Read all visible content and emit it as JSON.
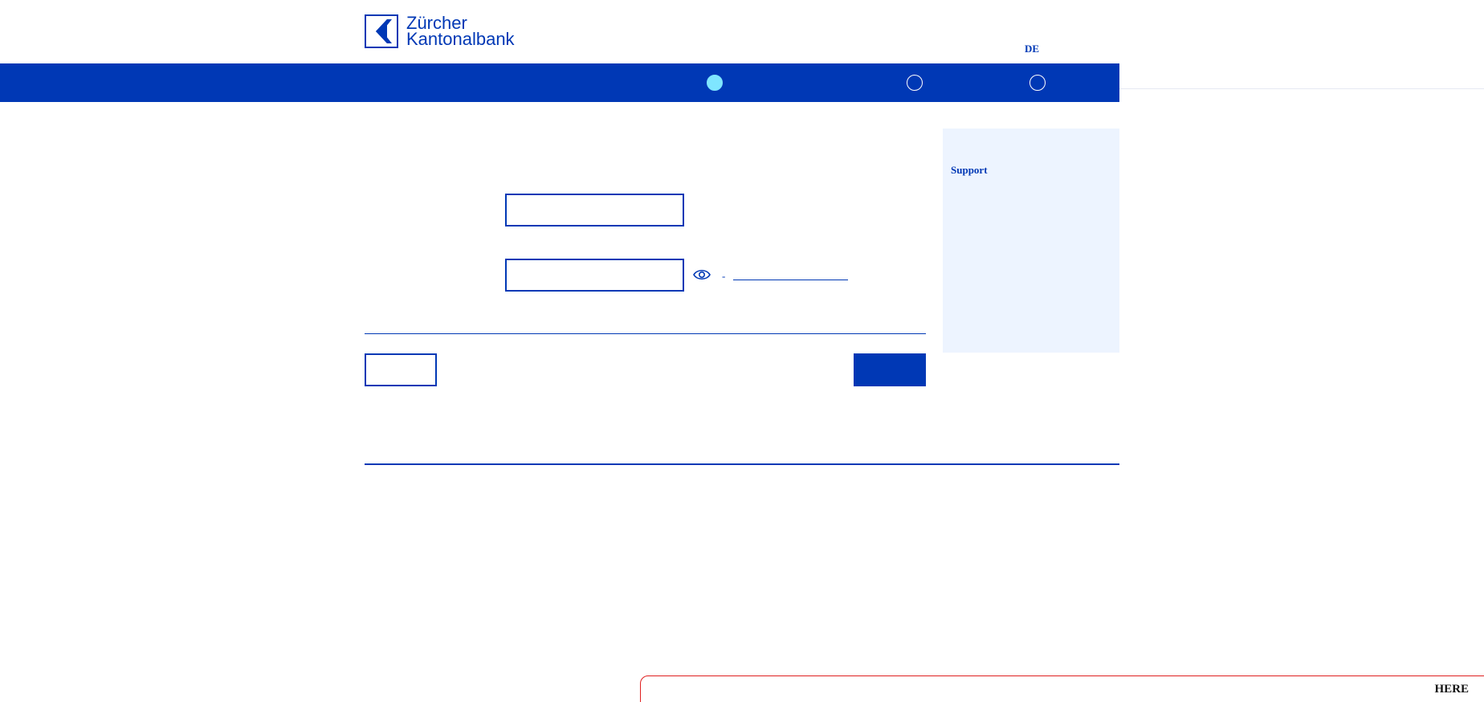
{
  "header": {
    "logo_line1": "Zürcher",
    "logo_line2": "Kantonalbank",
    "language": "DE"
  },
  "progress": {
    "steps": [
      {
        "state": "active"
      },
      {
        "state": "inactive"
      },
      {
        "state": "inactive"
      }
    ]
  },
  "form": {
    "username_value": "",
    "password_value": "",
    "separator": "-",
    "forgot_link": ""
  },
  "actions": {
    "back_label": "",
    "submit_label": ""
  },
  "sidebar": {
    "support_title": "Support"
  },
  "banner": {
    "text": "HERE"
  },
  "colors": {
    "brand_blue": "#0038b5",
    "active_step": "#7fe6ff",
    "sidebar_bg": "#edf4ff",
    "banner_border": "#e02020"
  }
}
